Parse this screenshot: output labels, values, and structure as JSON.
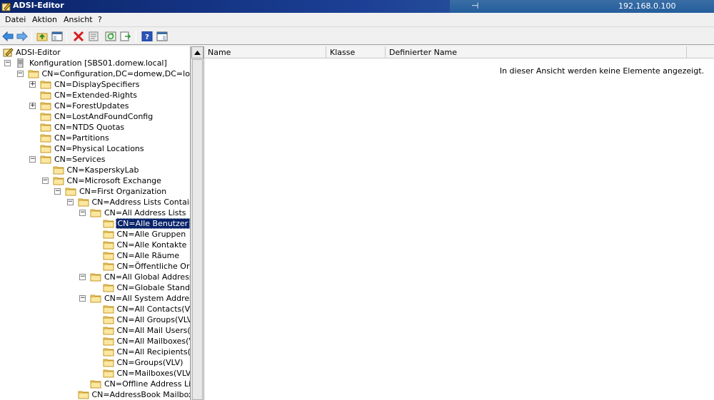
{
  "window": {
    "title": "ADSI-Editor",
    "remote_ip": "192.168.0.100"
  },
  "menu": {
    "items": [
      "Datei",
      "Aktion",
      "Ansicht",
      "?"
    ]
  },
  "toolbar": {
    "icons": [
      "back-icon",
      "forward-icon",
      "up-folder-icon",
      "show-hide-tree-icon",
      "delete-icon",
      "properties-icon",
      "refresh-icon",
      "export-list-icon",
      "help-icon",
      "show-hide-action-icon"
    ]
  },
  "tree": {
    "root": "ADSI-Editor",
    "nodes": [
      {
        "label": "Konfiguration [SBS01.domew.local]",
        "level": 0,
        "expander": "-",
        "icon": "server"
      },
      {
        "label": "CN=Configuration,DC=domew,DC=local",
        "level": 1,
        "expander": "-"
      },
      {
        "label": "CN=DisplaySpecifiers",
        "level": 2,
        "expander": "+"
      },
      {
        "label": "CN=Extended-Rights",
        "level": 2,
        "expander": ""
      },
      {
        "label": "CN=ForestUpdates",
        "level": 2,
        "expander": "+"
      },
      {
        "label": "CN=LostAndFoundConfig",
        "level": 2,
        "expander": ""
      },
      {
        "label": "CN=NTDS Quotas",
        "level": 2,
        "expander": ""
      },
      {
        "label": "CN=Partitions",
        "level": 2,
        "expander": ""
      },
      {
        "label": "CN=Physical Locations",
        "level": 2,
        "expander": ""
      },
      {
        "label": "CN=Services",
        "level": 2,
        "expander": "-"
      },
      {
        "label": "CN=KasperskyLab",
        "level": 3,
        "expander": ""
      },
      {
        "label": "CN=Microsoft Exchange",
        "level": 3,
        "expander": "-"
      },
      {
        "label": "CN=First Organization",
        "level": 4,
        "expander": "-"
      },
      {
        "label": "CN=Address Lists Container",
        "level": 5,
        "expander": "-"
      },
      {
        "label": "CN=All Address Lists",
        "level": 6,
        "expander": "-"
      },
      {
        "label": "CN=Alle Benutzer",
        "level": 7,
        "expander": "",
        "selected": true
      },
      {
        "label": "CN=Alle Gruppen",
        "level": 7,
        "expander": ""
      },
      {
        "label": "CN=Alle Kontakte",
        "level": 7,
        "expander": ""
      },
      {
        "label": "CN=Alle Räume",
        "level": 7,
        "expander": ""
      },
      {
        "label": "CN=Öffentliche Ordne",
        "level": 7,
        "expander": ""
      },
      {
        "label": "CN=All Global Address List",
        "level": 6,
        "expander": "-"
      },
      {
        "label": "CN=Globale Standarda",
        "level": 7,
        "expander": ""
      },
      {
        "label": "CN=All System Address Lis",
        "level": 6,
        "expander": "-"
      },
      {
        "label": "CN=All Contacts(VLV)",
        "level": 7,
        "expander": ""
      },
      {
        "label": "CN=All Groups(VLV)",
        "level": 7,
        "expander": ""
      },
      {
        "label": "CN=All Mail Users(VLV)",
        "level": 7,
        "expander": ""
      },
      {
        "label": "CN=All Mailboxes(VLV)",
        "level": 7,
        "expander": ""
      },
      {
        "label": "CN=All Recipients(VLV)",
        "level": 7,
        "expander": ""
      },
      {
        "label": "CN=Groups(VLV)",
        "level": 7,
        "expander": ""
      },
      {
        "label": "CN=Mailboxes(VLV)",
        "level": 7,
        "expander": ""
      },
      {
        "label": "CN=Offline Address Lists",
        "level": 6,
        "expander": ""
      },
      {
        "label": "CN=AddressBook Mailbox Polic",
        "level": 5,
        "expander": ""
      }
    ]
  },
  "list": {
    "columns": [
      "Name",
      "Klasse",
      "Definierter Name"
    ],
    "empty_message": "In dieser Ansicht werden keine Elemente angezeigt."
  },
  "colors": {
    "selection": "#0a246a",
    "folder": "#f5d77a"
  }
}
